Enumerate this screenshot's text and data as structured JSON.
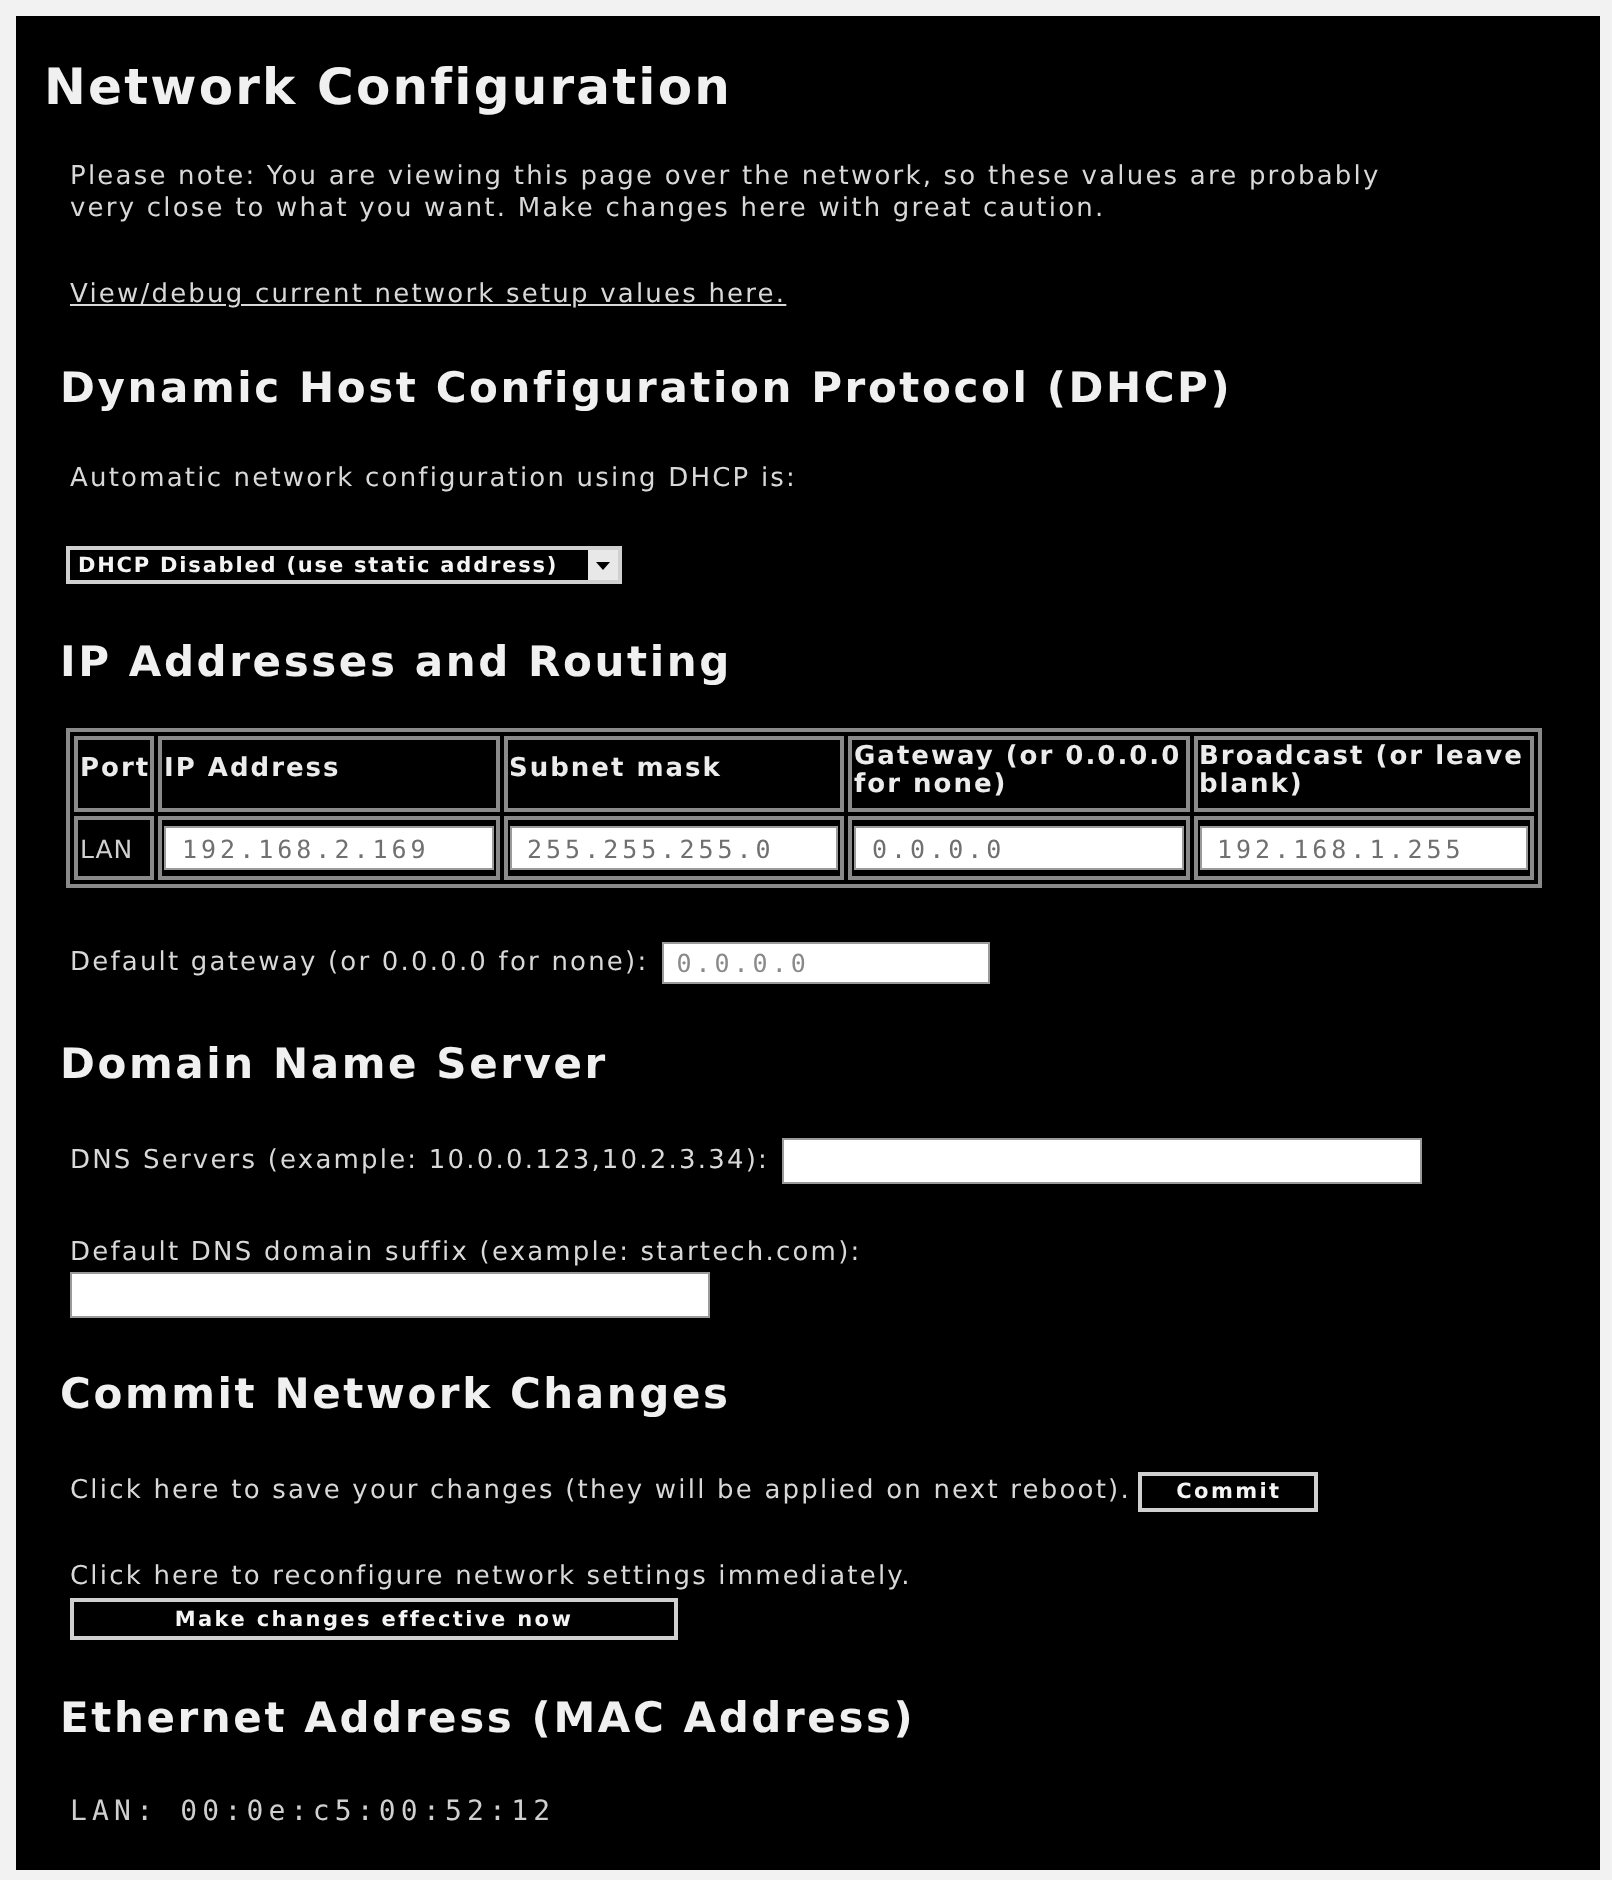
{
  "page": {
    "title": "Network Configuration"
  },
  "notice": {
    "text": "Please note: You are viewing this page over the network, so these values are probably very close to what you want. Make changes here with great caution.",
    "link": "View/debug current network setup values here."
  },
  "dhcp": {
    "heading": "Dynamic Host Configuration Protocol (DHCP)",
    "label": "Automatic network configuration using DHCP is:",
    "select": {
      "value": "DHCP Disabled (use static address)"
    }
  },
  "routing": {
    "heading": "IP Addresses and Routing",
    "table": {
      "columns": [
        "Port",
        "IP Address",
        "Subnet mask",
        "Gateway (or 0.0.0.0 for none)",
        "Broadcast (or leave blank)"
      ],
      "rows": [
        {
          "port": "LAN",
          "fields": [
            "192.168.2.169",
            "255.255.255.0",
            "0.0.0.0",
            "192.168.1.255"
          ]
        }
      ]
    },
    "default_gateway": {
      "label": "Default gateway (or 0.0.0.0 for none):",
      "value": "0.0.0.0"
    }
  },
  "dns": {
    "heading": "Domain Name Server",
    "fields": [
      {
        "kind": "inline",
        "label": "DNS Servers (example: 10.0.0.123,10.2.3.34):"
      },
      {
        "kind": "stacked",
        "label": "Default DNS domain suffix (example: startech.com):"
      }
    ]
  },
  "commit": {
    "heading": "Commit Network Changes",
    "actions": [
      {
        "kind": "inline",
        "text": "Click here to save your changes (they will be applied on next reboot).",
        "button": "Commit"
      },
      {
        "kind": "stacked",
        "text": "Click here to reconfigure network settings immediately.",
        "button": "Make changes effective now"
      }
    ]
  },
  "mac": {
    "heading": "Ethernet Address (MAC Address)",
    "entries": [
      "LAN: 00:0e:c5:00:52:12"
    ]
  }
}
